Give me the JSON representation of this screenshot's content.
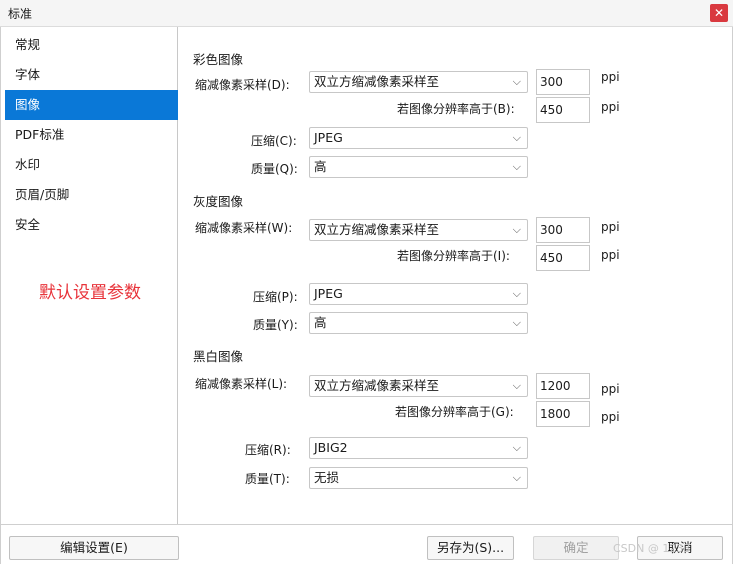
{
  "window": {
    "title": "标准",
    "close_icon": "✕"
  },
  "sidebar": {
    "items": [
      {
        "label": "常规",
        "selected": false
      },
      {
        "label": "字体",
        "selected": false
      },
      {
        "label": "图像",
        "selected": true
      },
      {
        "label": "PDF标准",
        "selected": false
      },
      {
        "label": "水印",
        "selected": false
      },
      {
        "label": "页眉/页脚",
        "selected": false
      },
      {
        "label": "安全",
        "selected": false
      }
    ],
    "note": "默认设置参数",
    "note_color": "#e8333a",
    "selected_color": "#0a78d7"
  },
  "color": {
    "title": "彩色图像",
    "downsample_label": "缩减像素采样(D):",
    "downsample_value": "双立方缩减像素采样至",
    "resolution": "300",
    "resolution_unit": "ppi",
    "threshold_label": "若图像分辨率高于(B):",
    "threshold": "450",
    "threshold_unit": "ppi",
    "compression_label": "压缩(C):",
    "compression_value": "JPEG",
    "quality_label": "质量(Q):",
    "quality_value": "高"
  },
  "gray": {
    "title": "灰度图像",
    "downsample_label": "缩减像素采样(W):",
    "downsample_value": "双立方缩减像素采样至",
    "resolution": "300",
    "resolution_unit": "ppi",
    "threshold_label": "若图像分辨率高于(I):",
    "threshold": "450",
    "threshold_unit": "ppi",
    "compression_label": "压缩(P):",
    "compression_value": "JPEG",
    "quality_label": "质量(Y):",
    "quality_value": "高"
  },
  "mono": {
    "title": "黑白图像",
    "downsample_label": "缩减像素采样(L):",
    "downsample_value": "双立方缩减像素采样至",
    "resolution": "1200",
    "resolution_unit": "ppi",
    "threshold_label": "若图像分辨率高于(G):",
    "threshold": "1800",
    "threshold_unit": "ppi",
    "compression_label": "压缩(R):",
    "compression_value": "JBIG2",
    "quality_label": "质量(T):",
    "quality_value": "无损"
  },
  "footer": {
    "edit_settings": "编辑设置(E)",
    "save_as": "另存为(S)...",
    "ok": "确定",
    "cancel": "取消",
    "watermark": "CSDN @  1233"
  },
  "icons": {
    "chevron": "⌵"
  }
}
